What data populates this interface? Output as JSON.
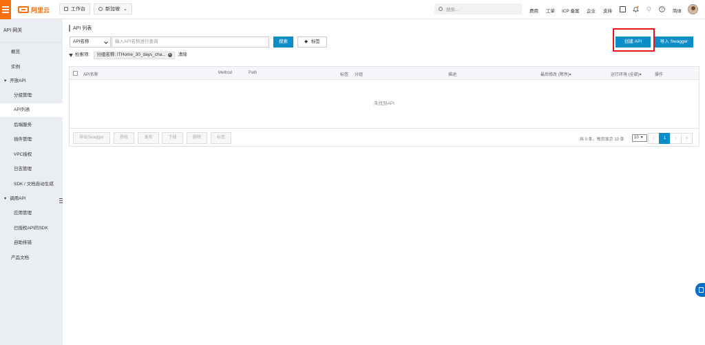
{
  "topbar": {
    "logo_text": "阿里云",
    "workbench": "工作台",
    "region": "新加坡",
    "search_placeholder": "搜索...",
    "nav": [
      "费用",
      "工单",
      "ICP 备案",
      "企业",
      "支持"
    ],
    "lang": "简体"
  },
  "sidebar": {
    "title": "API 网关",
    "items": [
      {
        "label": "概览"
      },
      {
        "label": "实例"
      },
      {
        "label": "开放API"
      },
      {
        "label": "分组管理"
      },
      {
        "label": "API列表"
      },
      {
        "label": "后端服务"
      },
      {
        "label": "插件管理"
      },
      {
        "label": "VPC授权"
      },
      {
        "label": "日志管理"
      },
      {
        "label": "SDK / 文档自动生成"
      },
      {
        "label": "调用API"
      },
      {
        "label": "应用管理"
      },
      {
        "label": "已授权API的SDK"
      },
      {
        "label": "自助排错"
      },
      {
        "label": "产品文档"
      }
    ]
  },
  "main": {
    "title": "API 列表",
    "create_api": "创建 API",
    "import_swagger": "导入 Swagger",
    "select_value": "API名称",
    "input_placeholder": "输入API名称进行查询",
    "search_btn": "搜索",
    "tag_btn": "标签",
    "filter_label": "检索项:",
    "filter_chip": "分组名称: ITHome_30_days_cha...",
    "filter_clear": "清除",
    "columns": {
      "name": "API名称",
      "method": "Method",
      "path": "Path",
      "tag": "标签",
      "group": "分组",
      "desc": "描述",
      "modified": "最后修改 (降序)",
      "env": "运行环境 (全部)",
      "ops": "操作"
    },
    "empty_text": "未找到API",
    "bulk": [
      "导出Swagger",
      "授权",
      "发布",
      "下线",
      "删除",
      "标签"
    ],
    "pager_info": "共 0 条，每页显示 10 条",
    "page_size": "10",
    "pages": [
      "‹",
      "1",
      "›",
      "»"
    ],
    "first_page": "«"
  }
}
